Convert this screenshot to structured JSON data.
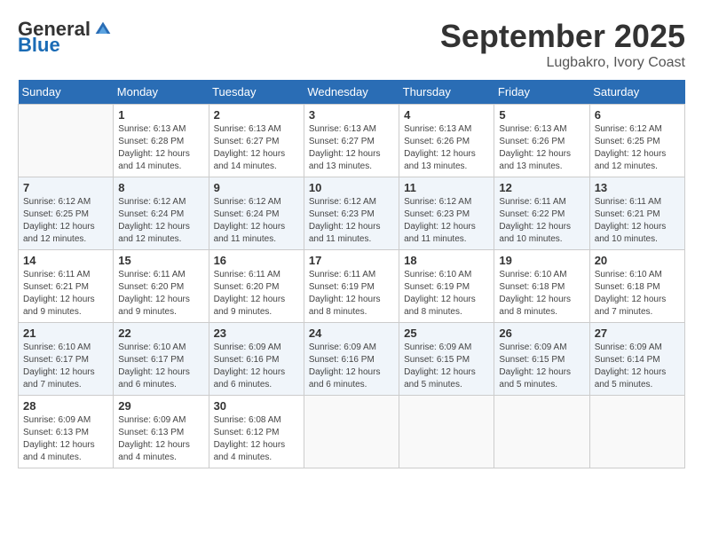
{
  "logo": {
    "general": "General",
    "blue": "Blue"
  },
  "title": "September 2025",
  "subtitle": "Lugbakro, Ivory Coast",
  "days_of_week": [
    "Sunday",
    "Monday",
    "Tuesday",
    "Wednesday",
    "Thursday",
    "Friday",
    "Saturday"
  ],
  "weeks": [
    [
      {
        "day": "",
        "info": ""
      },
      {
        "day": "1",
        "info": "Sunrise: 6:13 AM\nSunset: 6:28 PM\nDaylight: 12 hours\nand 14 minutes."
      },
      {
        "day": "2",
        "info": "Sunrise: 6:13 AM\nSunset: 6:27 PM\nDaylight: 12 hours\nand 14 minutes."
      },
      {
        "day": "3",
        "info": "Sunrise: 6:13 AM\nSunset: 6:27 PM\nDaylight: 12 hours\nand 13 minutes."
      },
      {
        "day": "4",
        "info": "Sunrise: 6:13 AM\nSunset: 6:26 PM\nDaylight: 12 hours\nand 13 minutes."
      },
      {
        "day": "5",
        "info": "Sunrise: 6:13 AM\nSunset: 6:26 PM\nDaylight: 12 hours\nand 13 minutes."
      },
      {
        "day": "6",
        "info": "Sunrise: 6:12 AM\nSunset: 6:25 PM\nDaylight: 12 hours\nand 12 minutes."
      }
    ],
    [
      {
        "day": "7",
        "info": "Sunrise: 6:12 AM\nSunset: 6:25 PM\nDaylight: 12 hours\nand 12 minutes."
      },
      {
        "day": "8",
        "info": "Sunrise: 6:12 AM\nSunset: 6:24 PM\nDaylight: 12 hours\nand 12 minutes."
      },
      {
        "day": "9",
        "info": "Sunrise: 6:12 AM\nSunset: 6:24 PM\nDaylight: 12 hours\nand 11 minutes."
      },
      {
        "day": "10",
        "info": "Sunrise: 6:12 AM\nSunset: 6:23 PM\nDaylight: 12 hours\nand 11 minutes."
      },
      {
        "day": "11",
        "info": "Sunrise: 6:12 AM\nSunset: 6:23 PM\nDaylight: 12 hours\nand 11 minutes."
      },
      {
        "day": "12",
        "info": "Sunrise: 6:11 AM\nSunset: 6:22 PM\nDaylight: 12 hours\nand 10 minutes."
      },
      {
        "day": "13",
        "info": "Sunrise: 6:11 AM\nSunset: 6:21 PM\nDaylight: 12 hours\nand 10 minutes."
      }
    ],
    [
      {
        "day": "14",
        "info": "Sunrise: 6:11 AM\nSunset: 6:21 PM\nDaylight: 12 hours\nand 9 minutes."
      },
      {
        "day": "15",
        "info": "Sunrise: 6:11 AM\nSunset: 6:20 PM\nDaylight: 12 hours\nand 9 minutes."
      },
      {
        "day": "16",
        "info": "Sunrise: 6:11 AM\nSunset: 6:20 PM\nDaylight: 12 hours\nand 9 minutes."
      },
      {
        "day": "17",
        "info": "Sunrise: 6:11 AM\nSunset: 6:19 PM\nDaylight: 12 hours\nand 8 minutes."
      },
      {
        "day": "18",
        "info": "Sunrise: 6:10 AM\nSunset: 6:19 PM\nDaylight: 12 hours\nand 8 minutes."
      },
      {
        "day": "19",
        "info": "Sunrise: 6:10 AM\nSunset: 6:18 PM\nDaylight: 12 hours\nand 8 minutes."
      },
      {
        "day": "20",
        "info": "Sunrise: 6:10 AM\nSunset: 6:18 PM\nDaylight: 12 hours\nand 7 minutes."
      }
    ],
    [
      {
        "day": "21",
        "info": "Sunrise: 6:10 AM\nSunset: 6:17 PM\nDaylight: 12 hours\nand 7 minutes."
      },
      {
        "day": "22",
        "info": "Sunrise: 6:10 AM\nSunset: 6:17 PM\nDaylight: 12 hours\nand 6 minutes."
      },
      {
        "day": "23",
        "info": "Sunrise: 6:09 AM\nSunset: 6:16 PM\nDaylight: 12 hours\nand 6 minutes."
      },
      {
        "day": "24",
        "info": "Sunrise: 6:09 AM\nSunset: 6:16 PM\nDaylight: 12 hours\nand 6 minutes."
      },
      {
        "day": "25",
        "info": "Sunrise: 6:09 AM\nSunset: 6:15 PM\nDaylight: 12 hours\nand 5 minutes."
      },
      {
        "day": "26",
        "info": "Sunrise: 6:09 AM\nSunset: 6:15 PM\nDaylight: 12 hours\nand 5 minutes."
      },
      {
        "day": "27",
        "info": "Sunrise: 6:09 AM\nSunset: 6:14 PM\nDaylight: 12 hours\nand 5 minutes."
      }
    ],
    [
      {
        "day": "28",
        "info": "Sunrise: 6:09 AM\nSunset: 6:13 PM\nDaylight: 12 hours\nand 4 minutes."
      },
      {
        "day": "29",
        "info": "Sunrise: 6:09 AM\nSunset: 6:13 PM\nDaylight: 12 hours\nand 4 minutes."
      },
      {
        "day": "30",
        "info": "Sunrise: 6:08 AM\nSunset: 6:12 PM\nDaylight: 12 hours\nand 4 minutes."
      },
      {
        "day": "",
        "info": ""
      },
      {
        "day": "",
        "info": ""
      },
      {
        "day": "",
        "info": ""
      },
      {
        "day": "",
        "info": ""
      }
    ]
  ]
}
